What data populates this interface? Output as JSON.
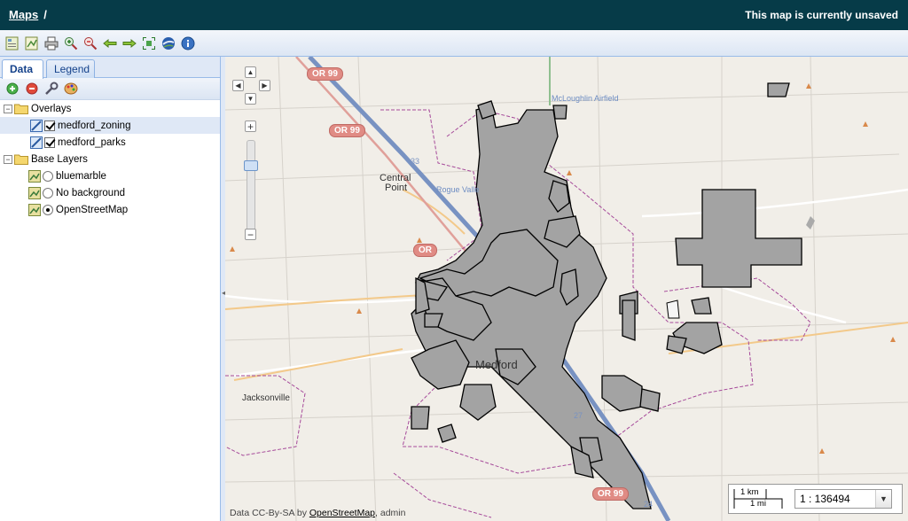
{
  "header": {
    "breadcrumb_link": "Maps",
    "breadcrumb_sep": "/",
    "status": "This map is currently unsaved"
  },
  "toolbar": {
    "icons": [
      "new-map-icon",
      "map-properties-icon",
      "print-icon",
      "zoom-in-icon",
      "zoom-out-icon",
      "back-arrow-icon",
      "forward-arrow-icon",
      "zoom-extent-icon",
      "google-earth-icon",
      "info-icon"
    ]
  },
  "tabs": {
    "data": "Data",
    "legend": "Legend"
  },
  "tree_toolbar": {
    "icons": [
      "add-layer-icon",
      "remove-layer-icon",
      "layer-properties-icon",
      "styles-icon"
    ]
  },
  "tree": {
    "overlays_label": "Overlays",
    "overlays": [
      "medford_zoning",
      "medford_parks"
    ],
    "base_label": "Base Layers",
    "base_layers": [
      "bluemarble",
      "No background",
      "OpenStreetMap"
    ]
  },
  "map": {
    "labels": {
      "airfield": "McLoughlin Airfield",
      "central_point_1": "Central",
      "central_point_2": "Point",
      "rogue": "Rogue Valle",
      "jacksonville": "Jacksonville",
      "medford": "Medford",
      "hwy33": "33",
      "hwy27": "27",
      "hwy24": "24"
    },
    "shields": {
      "or99_top": "OR 99",
      "or99_mid": "OR 99",
      "or99_left": "OR",
      "or99_bottom": "OR 99"
    },
    "attribution": {
      "prefix": "Data CC-By-SA by ",
      "link": "OpenStreetMap",
      "suffix": ", admin"
    },
    "scale": {
      "km": "1 km",
      "mi": "1 mi",
      "value": "1 : 136494"
    },
    "colors": {
      "background": "#f1eee8",
      "zoning_fill": "#a3a3a3",
      "zoning_stroke": "#000000",
      "boundary": "#a64a9a",
      "highway": "#7892c2"
    }
  }
}
